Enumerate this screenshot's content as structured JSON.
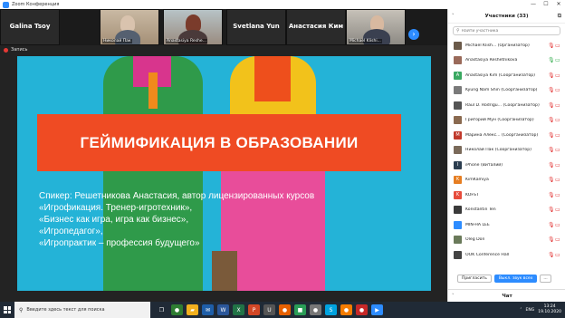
{
  "window": {
    "title": "Zoom Конференция",
    "controls": [
      "—",
      "☐",
      "✕"
    ]
  },
  "strip": {
    "tiles": [
      {
        "kind": "name",
        "big": "Galina Tsoy"
      },
      {
        "kind": "video",
        "small": "Николай Пак"
      },
      {
        "kind": "video",
        "small": "Anastasiya Reshe..."
      },
      {
        "kind": "name",
        "big": "Svetlana Yun"
      },
      {
        "kind": "name",
        "big": "Анастасия Ким"
      },
      {
        "kind": "video",
        "small": "Michael Klishi..."
      }
    ],
    "next": "›"
  },
  "recording": {
    "label": "Запись"
  },
  "slide": {
    "title": "ГЕЙМИФИКАЦИЯ В ОБРАЗОВАНИИ",
    "lines": [
      "Спикер: Решетникова Анастасия, автор лицензированных курсов",
      "«Игрофикация. Тренер-игротехник»,",
      "«Бизнес как игра, игра как бизнес»,",
      "«Игропедагог»,",
      "«Игропрактик – профессия будущего»"
    ]
  },
  "panel": {
    "title": "Участники (33)",
    "chevron": "˅",
    "popout": "⧉",
    "search_placeholder": "Найти участника",
    "participants": [
      {
        "initial": "",
        "name": "Michael Klish... (Организатор)",
        "color": "#6b5a4a",
        "mic": "off",
        "cam": "off"
      },
      {
        "initial": "",
        "name": "Anastasiya Reshetnikova",
        "color": "#9a6a5a",
        "mic": "on",
        "cam": "on"
      },
      {
        "initial": "A",
        "name": "Anastasiya Kim (Соорганизатор)",
        "color": "#3aa861",
        "mic": "off",
        "cam": "off"
      },
      {
        "initial": "",
        "name": "Kyung Nam Shin (Соорганизатор)",
        "color": "#7a7a7a",
        "mic": "off",
        "cam": "off"
      },
      {
        "initial": "",
        "name": "Raul D. Rodrigu... (Соорганизатор)",
        "color": "#555",
        "mic": "off",
        "cam": "off"
      },
      {
        "initial": "",
        "name": "Григорий Мун (Соорганизатор)",
        "color": "#8a6a50",
        "mic": "off",
        "cam": "off"
      },
      {
        "initial": "M",
        "name": "Марина Алекс... (Соорганизатор)",
        "color": "#c0392b",
        "mic": "off",
        "cam": "off"
      },
      {
        "initial": "",
        "name": "Николай Пак (Соорганизатор)",
        "color": "#7a6a5a",
        "mic": "off",
        "cam": "off"
      },
      {
        "initial": "I",
        "name": "iPhone (Виталий)",
        "color": "#2c3e50",
        "mic": "off",
        "cam": "off"
      },
      {
        "initial": "K",
        "name": "KimKamiya",
        "color": "#e67e22",
        "mic": "off",
        "cam": "off"
      },
      {
        "initial": "K",
        "name": "KOFST",
        "color": "#e74c3c",
        "mic": "off",
        "cam": "off"
      },
      {
        "initial": "",
        "name": "Konstantin Ten",
        "color": "#3a3a3a",
        "mic": "off",
        "cam": "off"
      },
      {
        "initial": "",
        "name": "MIN-HA LEE",
        "color": "#2d8cff",
        "mic": "off",
        "cam": "off"
      },
      {
        "initial": "",
        "name": "Oleg Don",
        "color": "#6a7a5a",
        "mic": "off",
        "cam": "off"
      },
      {
        "initial": "",
        "name": "OOK Conference Hall",
        "color": "#444",
        "mic": "off",
        "cam": "off"
      }
    ],
    "buttons": {
      "invite": "Пригласить",
      "mute_all": "Выкл. звук всех",
      "more": "..."
    },
    "chat": "Чат"
  },
  "taskbar": {
    "search_placeholder": "Введите здесь текст для поиска",
    "apps": [
      {
        "name": "task-view",
        "glyph": "❐",
        "color": "#202a36"
      },
      {
        "name": "chrome",
        "glyph": "●",
        "color": "#2e7d32"
      },
      {
        "name": "file-explorer",
        "glyph": "▰",
        "color": "#f2b01e"
      },
      {
        "name": "mail",
        "glyph": "✉",
        "color": "#1e5ea8"
      },
      {
        "name": "word",
        "glyph": "W",
        "color": "#2b579a"
      },
      {
        "name": "excel",
        "glyph": "X",
        "color": "#217346"
      },
      {
        "name": "powerpoint",
        "glyph": "P",
        "color": "#d24726"
      },
      {
        "name": "app-u",
        "glyph": "U",
        "color": "#555"
      },
      {
        "name": "firefox",
        "glyph": "●",
        "color": "#e66000"
      },
      {
        "name": "app-green",
        "glyph": "■",
        "color": "#2a9d57"
      },
      {
        "name": "app-chrome2",
        "glyph": "●",
        "color": "#777"
      },
      {
        "name": "app-s",
        "glyph": "S",
        "color": "#00a3e0"
      },
      {
        "name": "app-orange",
        "glyph": "●",
        "color": "#f57c00"
      },
      {
        "name": "app-red",
        "glyph": "●",
        "color": "#c62828"
      },
      {
        "name": "zoom",
        "glyph": "▶",
        "color": "#2d8cff"
      }
    ],
    "tray": {
      "arrow": "˄",
      "lang": "ENG",
      "time": "13:24",
      "date": "19.10.2020"
    }
  }
}
